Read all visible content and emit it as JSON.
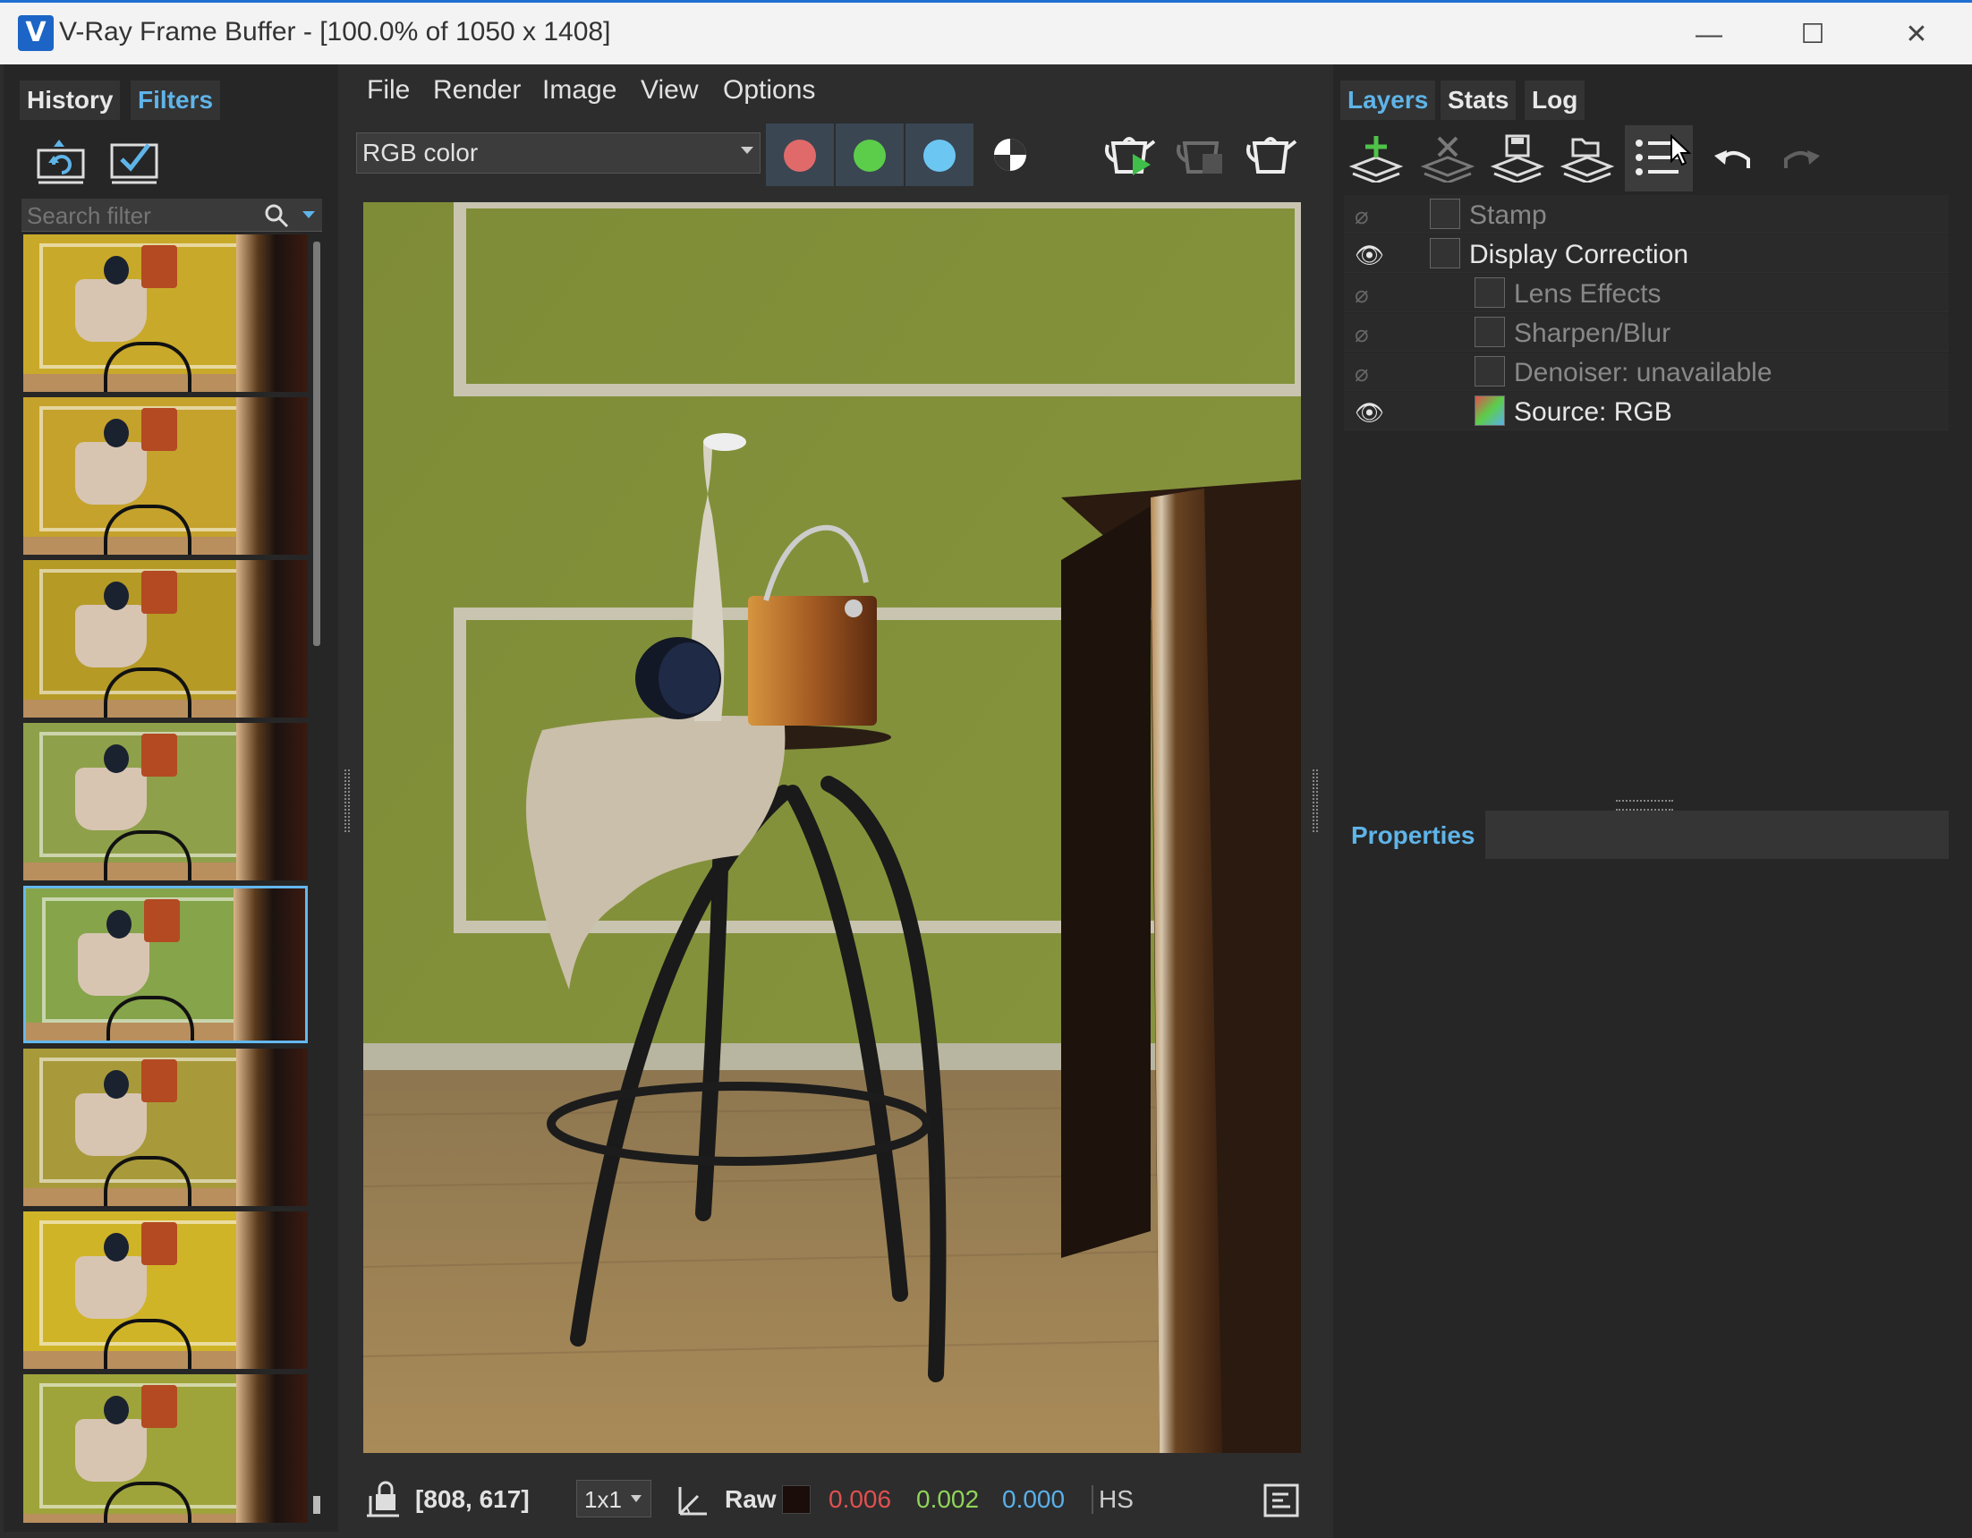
{
  "window": {
    "title": "V-Ray Frame Buffer - [100.0% of 1050 x 1408]",
    "logo_letter": "V",
    "minimize_glyph": "—",
    "maximize_glyph": "☐",
    "close_glyph": "✕"
  },
  "left_panel": {
    "tabs": [
      {
        "label": "History"
      },
      {
        "label": "Filters"
      }
    ],
    "active_tab": "Filters",
    "search": {
      "placeholder": "Search filter",
      "value": ""
    },
    "thumbnails": [
      {
        "wall": "#c9a92a",
        "selected": false
      },
      {
        "wall": "#c5a22c",
        "selected": false
      },
      {
        "wall": "#b59a26",
        "selected": false
      },
      {
        "wall": "#8fa04a",
        "selected": false
      },
      {
        "wall": "#86a44a",
        "selected": true
      },
      {
        "wall": "#a89a3a",
        "selected": false
      },
      {
        "wall": "#d0b428",
        "selected": false
      },
      {
        "wall": "#9ea43a",
        "selected": false
      }
    ]
  },
  "menubar": {
    "items": [
      "File",
      "Render",
      "Image",
      "View",
      "Options"
    ]
  },
  "toolbar": {
    "channel": "RGB color",
    "channel_colors": {
      "red": "#e06a6a",
      "green": "#5ccd4a",
      "blue": "#6cc6f2"
    }
  },
  "statusbar": {
    "coords": "[808, 617]",
    "zoom": "1x1",
    "mode": "Raw",
    "r": "0.006",
    "g": "0.002",
    "b": "0.000",
    "hs": "HS",
    "r_color": "#e05050",
    "g_color": "#8fd45a",
    "b_color": "#5ab0ea"
  },
  "right_panel": {
    "tabs": [
      {
        "label": "Layers"
      },
      {
        "label": "Stats"
      },
      {
        "label": "Log"
      }
    ],
    "active_tab": "Layers",
    "layers": [
      {
        "name": "Stamp",
        "visible": false,
        "icon": "stamp-icon"
      },
      {
        "name": "Display Correction",
        "visible": true,
        "icon": "curve-icon"
      },
      {
        "name": "Lens Effects",
        "visible": false,
        "icon": "lens-effects-icon"
      },
      {
        "name": "Sharpen/Blur",
        "visible": false,
        "icon": "sharpen-icon"
      },
      {
        "name": "Denoiser: unavailable",
        "visible": false,
        "icon": "denoiser-icon"
      },
      {
        "name": "Source: RGB",
        "visible": true,
        "icon": "source-rgb-icon"
      }
    ],
    "properties_title": "Properties"
  }
}
